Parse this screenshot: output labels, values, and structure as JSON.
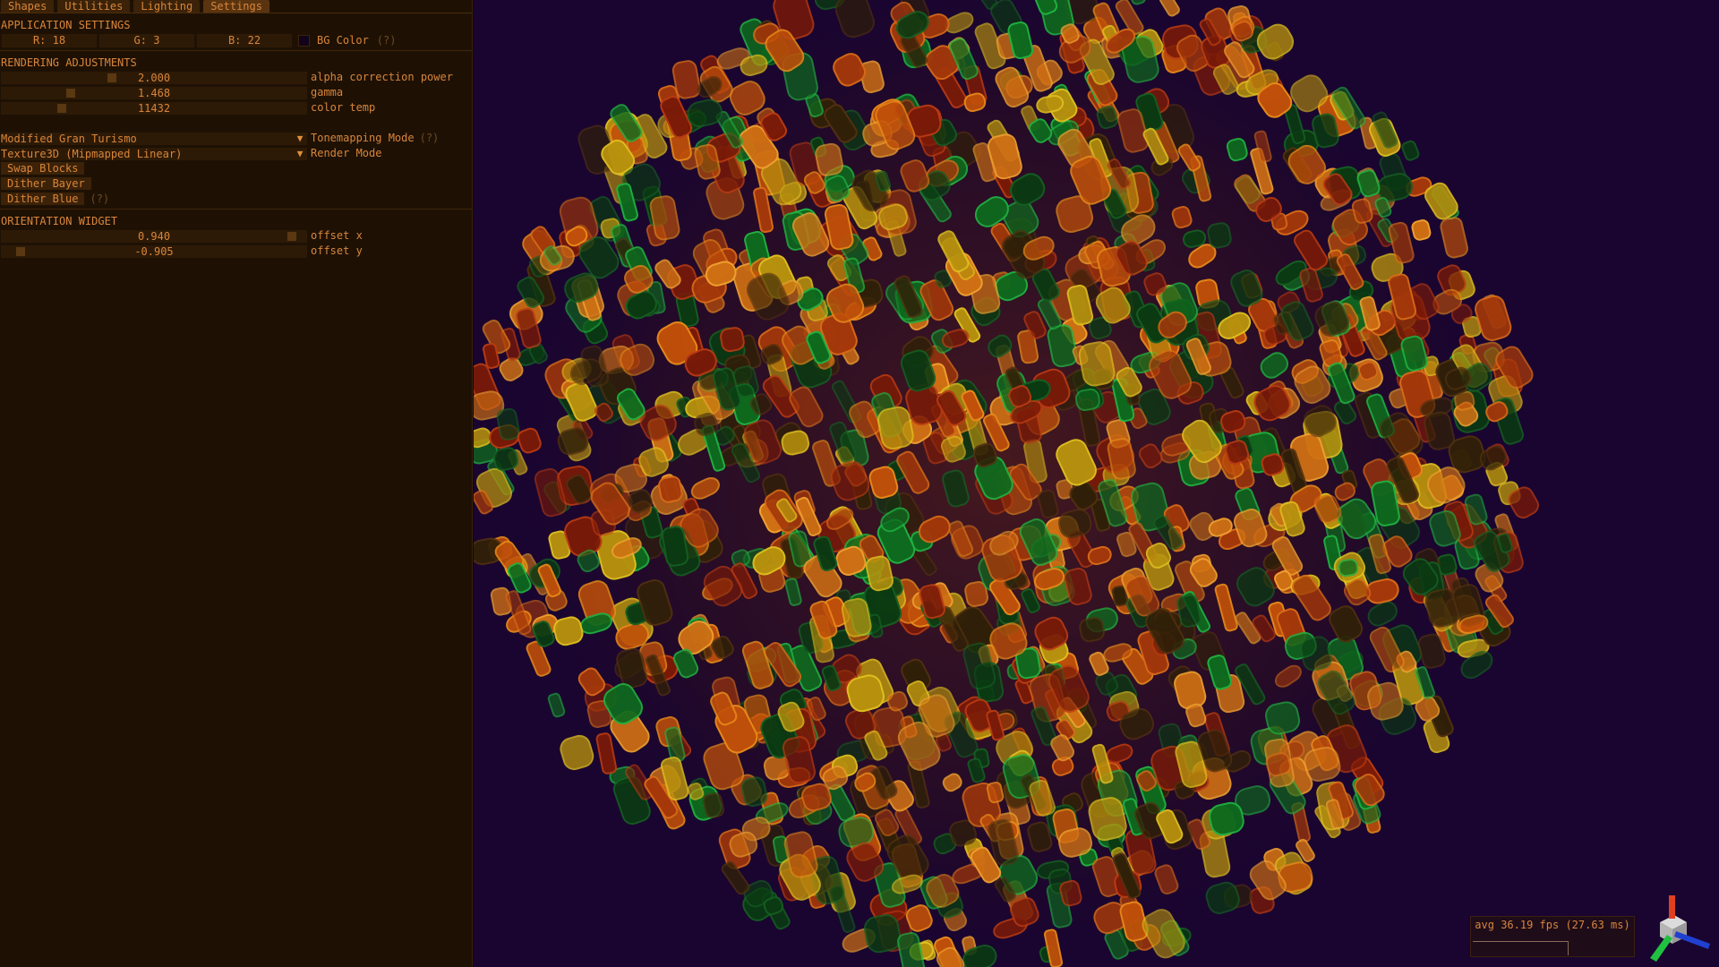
{
  "tabs": [
    "Shapes",
    "Utilities",
    "Lighting",
    "Settings"
  ],
  "app_settings": {
    "header": "APPLICATION SETTINGS",
    "r": "R: 18",
    "g": "G: 3",
    "b": "B: 22",
    "bg_label": "BG Color",
    "help": "(?)",
    "bg_color": "#12031a"
  },
  "rendering": {
    "header": "RENDERING ADJUSTMENTS",
    "sliders": [
      {
        "value": "2.000",
        "label": "alpha correction power",
        "fraction": 0.36
      },
      {
        "value": "1.468",
        "label": "gamma",
        "fraction": 0.22
      },
      {
        "value": "11432",
        "label": "color temp",
        "fraction": 0.19
      }
    ],
    "tonemap_value": "Modified Gran Turismo",
    "tonemap_label": "Tonemapping Mode",
    "tonemap_help": "(?)",
    "render_value": "Texture3D (Mipmapped Linear)",
    "render_label": "Render Mode",
    "swap_blocks": "Swap Blocks",
    "dither_bayer": "Dither Bayer",
    "dither_blue": "Dither Blue",
    "dither_help": "(?)"
  },
  "orientation": {
    "header": "ORIENTATION WIDGET",
    "offset_x": {
      "value": "0.940",
      "label": "offset x",
      "fraction": 0.97
    },
    "offset_y": {
      "value": "-0.905",
      "label": "offset y",
      "fraction": 0.05
    }
  },
  "viewport": {
    "fps_text": "avg 36.19 fps (27.63 ms)",
    "background": "#1a0530"
  },
  "icons": [
    "orientation-gizmo-icon",
    "dropdown-arrow-icon",
    "color-swatch-icon"
  ]
}
